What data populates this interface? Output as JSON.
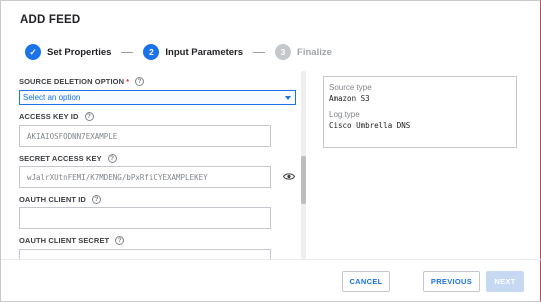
{
  "dialog": {
    "title": "ADD FEED"
  },
  "stepper": {
    "steps": [
      {
        "number": "✓",
        "label": "Set Properties",
        "state": "done"
      },
      {
        "number": "2",
        "label": "Input Parameters",
        "state": "active"
      },
      {
        "number": "3",
        "label": "Finalize",
        "state": "pending"
      }
    ]
  },
  "form": {
    "source_deletion": {
      "label": "SOURCE DELETION OPTION",
      "required_mark": "*",
      "value": "Select an option"
    },
    "access_key": {
      "label": "ACCESS KEY ID",
      "placeholder": "AKIAIOSFODNN7EXAMPLE"
    },
    "secret_key": {
      "label": "SECRET ACCESS KEY",
      "placeholder": "wJalrXUtnFEMI/K7MDENG/bPxRfiCYEXAMPLEKEY"
    },
    "oauth_client_id": {
      "label": "OAUTH CLIENT ID",
      "value": ""
    },
    "oauth_client_secret": {
      "label": "OAUTH CLIENT SECRET",
      "value": ""
    },
    "help_glyph": "?"
  },
  "info_panel": {
    "source_type_label": "Source type",
    "source_type_value": "Amazon S3",
    "log_type_label": "Log type",
    "log_type_value": "Cisco Umbrella DNS"
  },
  "footer": {
    "cancel": "CANCEL",
    "previous": "PREVIOUS",
    "next": "NEXT"
  },
  "colors": {
    "accent": "#1a73e8",
    "required": "#d93025",
    "disabled_button": "#c7d9f2"
  }
}
